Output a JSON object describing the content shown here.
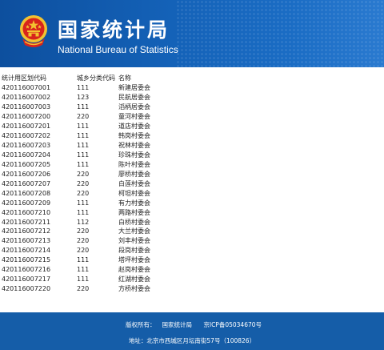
{
  "header": {
    "title_zh": "国家统计局",
    "title_en": "National Bureau of Statistics",
    "colors": {
      "background": "#1462b8",
      "emblem_red": "#d8241c",
      "emblem_gold": "#f2c230"
    }
  },
  "table": {
    "columns": [
      "统计用区划代码",
      "城乡分类代码",
      "名称"
    ],
    "rows": [
      [
        "420116007001",
        "111",
        "新建居委会"
      ],
      [
        "420116007002",
        "123",
        "民航居委会"
      ],
      [
        "420116007003",
        "111",
        "滔柄居委会"
      ],
      [
        "420116007200",
        "220",
        "童河村委会"
      ],
      [
        "420116007201",
        "111",
        "道店村委会"
      ],
      [
        "420116007202",
        "111",
        "韩岗村委会"
      ],
      [
        "420116007203",
        "111",
        "祝林村委会"
      ],
      [
        "420116007204",
        "111",
        "珍珠村委会"
      ],
      [
        "420116007205",
        "111",
        "陈叶村委会"
      ],
      [
        "420116007206",
        "220",
        "廖桥村委会"
      ],
      [
        "420116007207",
        "220",
        "白莲村委会"
      ],
      [
        "420116007208",
        "220",
        "柯坦村委会"
      ],
      [
        "420116007209",
        "111",
        "有力村委会"
      ],
      [
        "420116007210",
        "111",
        "两路村委会"
      ],
      [
        "420116007211",
        "112",
        "白桥村委会"
      ],
      [
        "420116007212",
        "220",
        "大兰村委会"
      ],
      [
        "420116007213",
        "220",
        "刘丰村委会"
      ],
      [
        "420116007214",
        "220",
        "段岗村委会"
      ],
      [
        "420116007215",
        "111",
        "塔坪村委会"
      ],
      [
        "420116007216",
        "111",
        "赵岗村委会"
      ],
      [
        "420116007217",
        "111",
        "红湖村委会"
      ],
      [
        "420116007220",
        "220",
        "方桥村委会"
      ]
    ]
  },
  "footer": {
    "copyright_label": "版权所有：",
    "copyright_owner": "国家统计局",
    "icp": "京ICP备05034670号",
    "address": "地址：北京市西城区月坛南街57号（100826）"
  }
}
